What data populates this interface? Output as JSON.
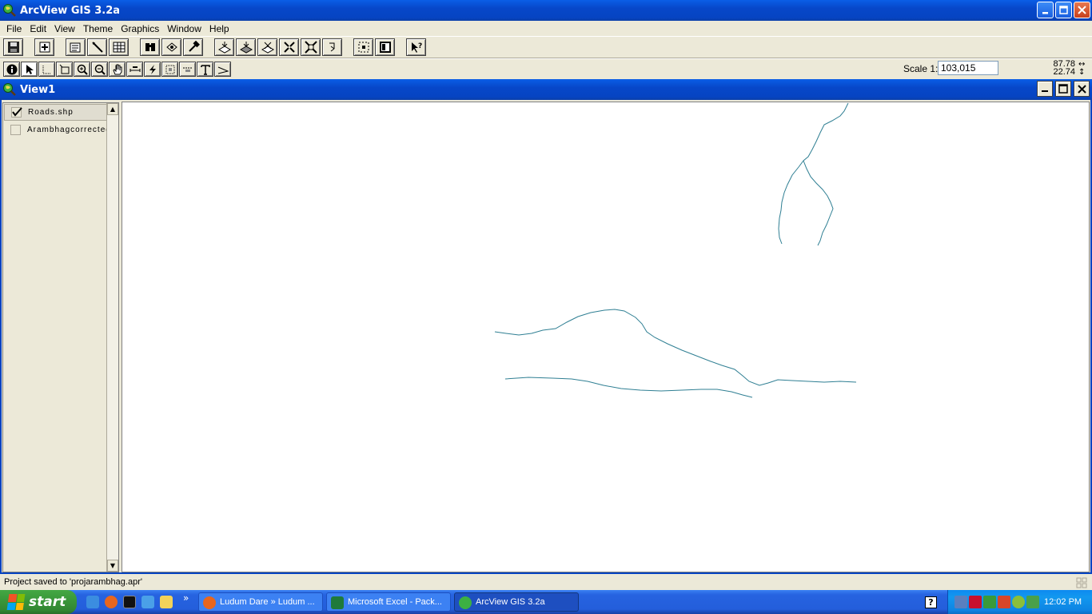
{
  "app": {
    "title": "ArcView GIS 3.2a",
    "title_icon": "arcview-globe-icon"
  },
  "menu": [
    {
      "label": "File"
    },
    {
      "label": "Edit"
    },
    {
      "label": "View"
    },
    {
      "label": "Theme"
    },
    {
      "label": "Graphics"
    },
    {
      "label": "Window"
    },
    {
      "label": "Help"
    }
  ],
  "toolbar": {
    "scale_label": "Scale 1:",
    "scale_value": "103,015",
    "coord_x": "87.78",
    "coord_y": "22.74"
  },
  "view": {
    "title": "View1",
    "layers": [
      {
        "name": "Roads.shp",
        "checked": true
      },
      {
        "name": "Arambhagcorrected",
        "checked": false
      }
    ],
    "map_line_color": "#2f7f93"
  },
  "status": {
    "message": "Project saved to 'projarambhag.apr'"
  },
  "taskbar": {
    "start_label": "start",
    "tasks": [
      {
        "label": "Ludum Dare » Ludum ..."
      },
      {
        "label": "Microsoft Excel - Pack..."
      },
      {
        "label": "ArcView GIS 3.2a"
      }
    ],
    "overflow": "»",
    "clock": "12:02 PM"
  }
}
